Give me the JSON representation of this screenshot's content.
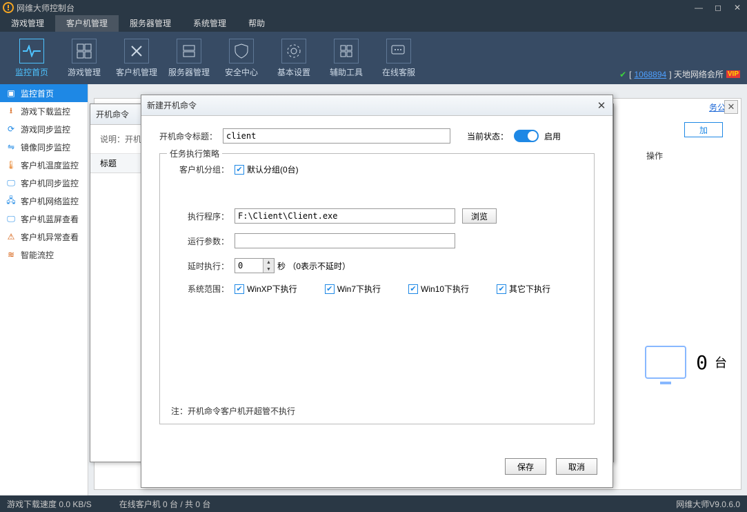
{
  "window": {
    "title": "网维大师控制台"
  },
  "menu": [
    "游戏管理",
    "客户机管理",
    "服务器管理",
    "系统管理",
    "帮助"
  ],
  "menu_active": 1,
  "toolbar": {
    "items": [
      {
        "label": "监控首页"
      },
      {
        "label": "游戏管理"
      },
      {
        "label": "客户机管理"
      },
      {
        "label": "服务器管理"
      },
      {
        "label": "安全中心"
      },
      {
        "label": "基本设置"
      },
      {
        "label": "辅助工具"
      },
      {
        "label": "在线客服"
      }
    ],
    "active": 0,
    "status_id": "1068894",
    "status_name": "天地网络会所",
    "vip": "VIP"
  },
  "sidebar": {
    "items": [
      "监控首页",
      "游戏下载监控",
      "游戏同步监控",
      "镜像同步监控",
      "客户机温度监控",
      "客户机同步监控",
      "客户机网络监控",
      "客户机蓝屏查看",
      "客户机异常查看",
      "智能流控"
    ],
    "active": 0
  },
  "bg_panel": {
    "more_link": "务公告",
    "add_btn": "加",
    "op_header": "操作",
    "count_value": "0",
    "count_unit": "台"
  },
  "dlg1": {
    "title": "开机命令",
    "desc_prefix": "说明：开机",
    "col_title": "标题"
  },
  "dlg2": {
    "title": "新建开机命令",
    "cmdtitle_label": "开机命令标题：",
    "cmdtitle_value": "client",
    "status_label": "当前状态：",
    "status_text": "启用",
    "fieldset_legend": "任务执行策略",
    "group_label": "客户机分组：",
    "group_default": "默认分组(0台)",
    "exec_label": "执行程序：",
    "exec_value": "F:\\Client\\Client.exe",
    "browse": "浏览",
    "param_label": "运行参数：",
    "param_value": "",
    "delay_label": "延时执行：",
    "delay_value": "0",
    "delay_suffix": "秒  （0表示不延时）",
    "scope_label": "系统范围：",
    "scope_opts": [
      "WinXP下执行",
      "Win7下执行",
      "Win10下执行",
      "其它下执行"
    ],
    "note": "注：开机命令客户机开超管不执行",
    "save": "保存",
    "cancel": "取消"
  },
  "status": {
    "speed": "游戏下载速度 0.0 KB/S",
    "clients": "在线客户机 0 台 / 共 0 台",
    "version": "网维大师V9.0.6.0"
  }
}
